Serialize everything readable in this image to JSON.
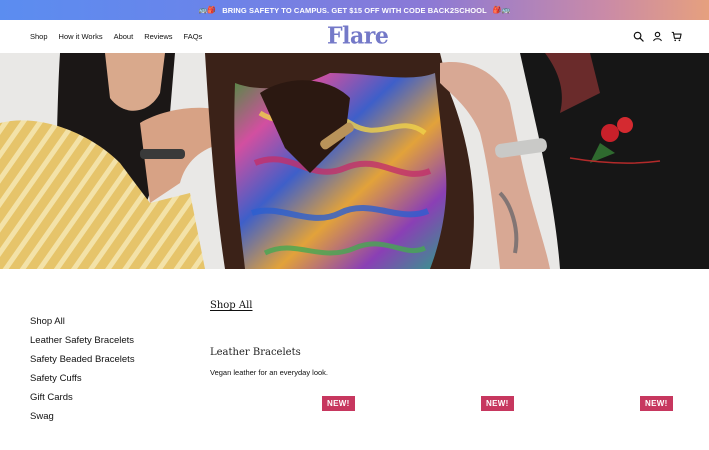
{
  "promo": {
    "icon_left": "🚌🎒",
    "text": "BRING SAFETY TO CAMPUS. GET $15 OFF WITH CODE BACK2SCHOOL",
    "icon_right": "🎒🚌"
  },
  "nav": {
    "links": [
      "Shop",
      "How it Works",
      "About",
      "Reviews",
      "FAQs"
    ],
    "logo": "Flare",
    "icons": [
      "search-icon",
      "account-icon",
      "cart-icon"
    ]
  },
  "colors": {
    "brand": "#7479c8",
    "badge": "#c7375f"
  },
  "sidebar": {
    "items": [
      "Shop All",
      "Leather Safety Bracelets",
      "Safety Beaded Bracelets",
      "Safety Cuffs",
      "Gift Cards",
      "Swag"
    ]
  },
  "main": {
    "heading": "Shop All",
    "category_title": "Leather Bracelets",
    "category_description": "Vegan leather for an everyday look.",
    "badges": [
      "NEW!",
      "NEW!",
      "NEW!"
    ]
  }
}
